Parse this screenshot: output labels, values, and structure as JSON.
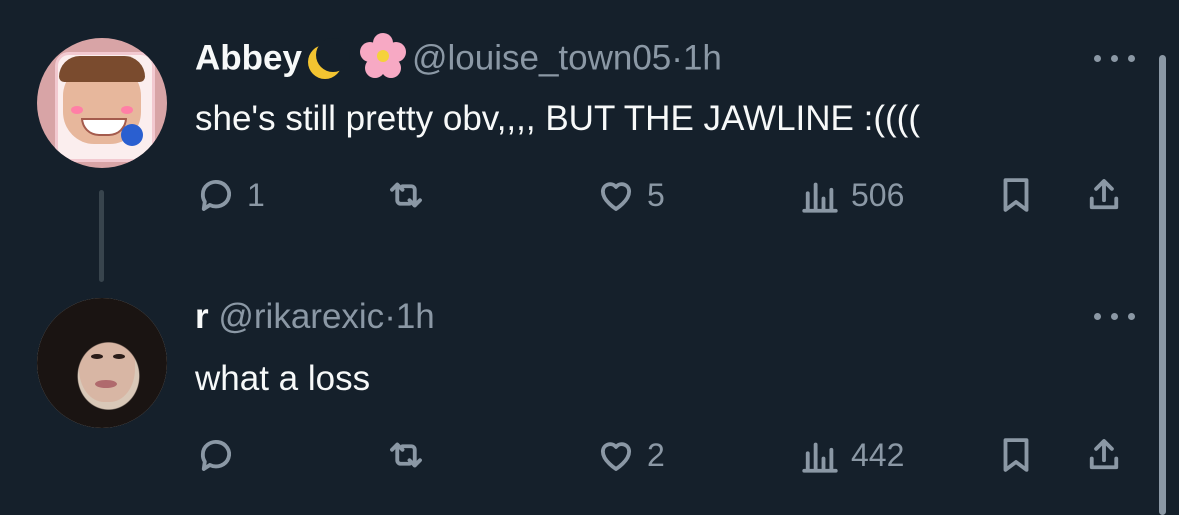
{
  "tweets": [
    {
      "display_name": "Abbey",
      "handle": "@louise_town05",
      "separator": "·",
      "time": "1h",
      "text": "she's still pretty obv,,,, BUT THE JAWLINE :((((",
      "emojis": [
        "crescent-moon",
        "cherry-blossom"
      ],
      "replies": "1",
      "retweets": "",
      "likes": "5",
      "views": "506"
    },
    {
      "display_name": "r",
      "handle": "@rikarexic",
      "separator": "·",
      "time": "1h",
      "text": "what a loss",
      "emojis": [],
      "replies": "",
      "retweets": "",
      "likes": "2",
      "views": "442"
    }
  ],
  "colors": {
    "background": "#15202b",
    "text_primary": "#f7f9f9",
    "text_muted": "#8b98a5",
    "thread_line": "#38444d"
  }
}
